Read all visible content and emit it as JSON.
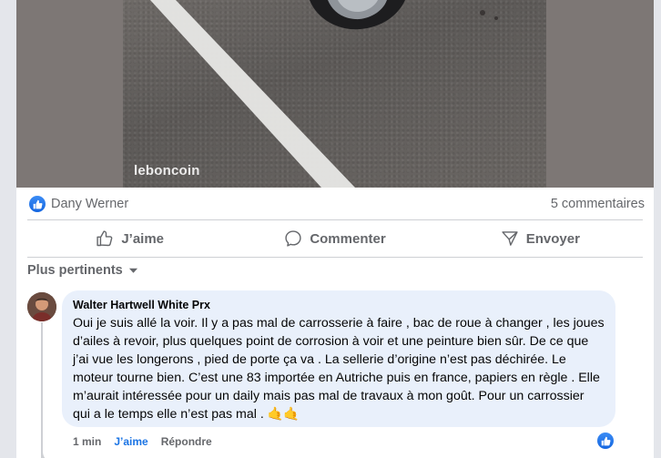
{
  "post": {
    "watermark": "leboncoin"
  },
  "reactions": {
    "liker": "Dany Werner",
    "comments_count": "5 commentaires"
  },
  "actions": {
    "like": "J’aime",
    "comment": "Commenter",
    "share": "Envoyer"
  },
  "sort": {
    "label": "Plus pertinents"
  },
  "comment": {
    "author": "Walter Hartwell White Prx",
    "text": "Oui je suis allé la voir. Il y a pas mal de carrosserie à faire , bac de roue à changer , les joues d’ailes à revoir, plus quelques point de corrosion à voir et une peinture bien sûr. De ce que j’ai vue les longerons , pied de porte ça va . La sellerie d’origine n’est pas déchirée. Le moteur tourne bien. C’est une 83 importée en Autriche puis en france, papiers en règle . Elle m’aurait intéressée pour un daily mais pas mal de travaux à mon goût. Pour un carrossier qui a le temps elle n’est pas mal . 🤙🤙",
    "time": "1 min",
    "like_label": "J’aime",
    "reply_label": "Répondre"
  },
  "colors": {
    "accent": "#1b74e4",
    "bubble": "#e9f0fb",
    "muted_text": "#65676b"
  }
}
